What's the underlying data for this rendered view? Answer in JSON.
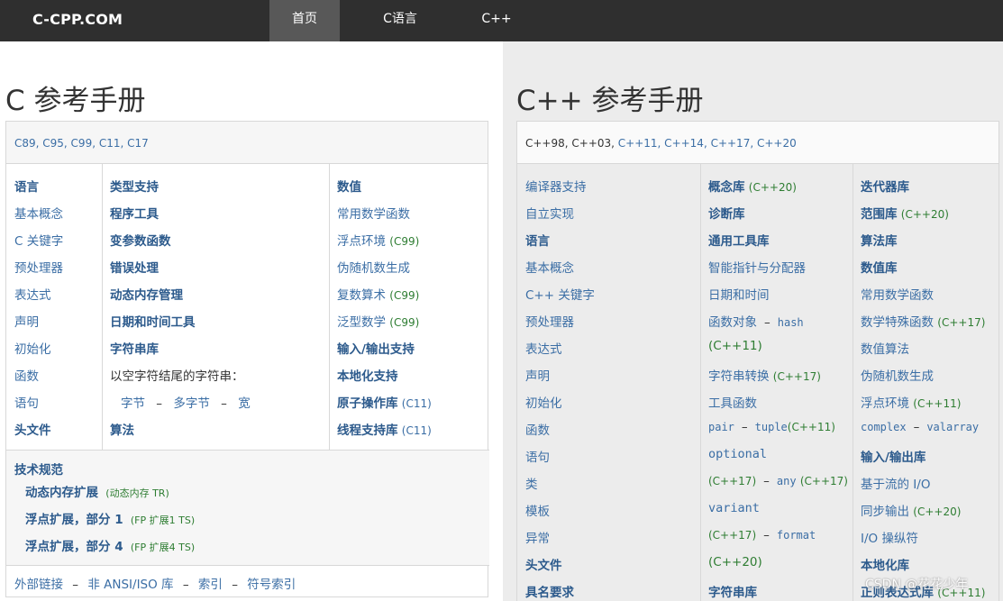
{
  "nav": {
    "brand": "C-CPP.COM",
    "items": [
      "首页",
      "C语言",
      "C++"
    ]
  },
  "c_ref": {
    "title": "C 参考手册",
    "standards": "C89, C95, C99, C11, C17",
    "col1": [
      "语言",
      "基本概念",
      "C 关键字",
      "预处理器",
      "表达式",
      "声明",
      "初始化",
      "函数",
      "语句",
      "头文件"
    ],
    "col2": [
      "类型支持",
      "程序工具",
      "变参数函数",
      "错误处理",
      "动态内存管理",
      "日期和时间工具",
      "字符串库",
      "以空字符结尾的字符串：",
      "字节",
      "–",
      "多字节",
      "–",
      "宽",
      "算法"
    ],
    "col3": [
      {
        "label": "数值",
        "tag": ""
      },
      {
        "label": "常用数学函数",
        "tag": ""
      },
      {
        "label": "浮点环境",
        "tag": "(C99)"
      },
      {
        "label": "伪随机数生成",
        "tag": ""
      },
      {
        "label": "复数算术",
        "tag": "(C99)"
      },
      {
        "label": "泛型数学",
        "tag": "(C99)"
      },
      {
        "label": "输入/输出支持",
        "tag": ""
      },
      {
        "label": "本地化支持",
        "tag": ""
      },
      {
        "label": "原子操作库",
        "tag": "(C11)"
      },
      {
        "label": "线程支持库",
        "tag": "(C11)"
      }
    ],
    "tech_specs": {
      "title": "技术规范",
      "items": [
        {
          "label": "动态内存扩展",
          "tag": "(动态内存 TR)"
        },
        {
          "label": "浮点扩展，部分 1",
          "tag": "(FP 扩展1 TS)"
        },
        {
          "label": "浮点扩展，部分 4",
          "tag": "(FP 扩展4 TS)"
        }
      ]
    },
    "footer": [
      "外部链接",
      "–",
      "非 ANSI/ISO 库",
      "–",
      "索引",
      "–",
      "符号索引"
    ]
  },
  "cpp_ref": {
    "title": "C++ 参考手册",
    "standards_plain": "C++98, C++03,",
    "standards_links": "C++11, C++14, C++17, C++20",
    "col1": [
      "编译器支持",
      "自立实现",
      "语言",
      "基本概念",
      "C++ 关键字",
      "预处理器",
      "表达式",
      "声明",
      "初始化",
      "函数",
      "语句",
      "类",
      "模板",
      "异常",
      "头文件",
      "具名要求"
    ],
    "col2": {
      "concepts": "概念库",
      "concepts_tag": "(C++20)",
      "diagnostics": "诊断库",
      "utilities": "通用工具库",
      "smart_ptr": "智能指针与分配器",
      "datetime": "日期和时间",
      "func_obj": "函数对象",
      "dash": "–",
      "hash": "hash",
      "cpp11": "(C++11)",
      "str_conv": "字符串转换",
      "cpp17": "(C++17)",
      "util_func": "工具函数",
      "pair": "pair",
      "tuple": "tuple",
      "tuple_tag": "(C++11)",
      "optional": "optional",
      "opt_tag": "(C++17)",
      "any": "any",
      "any_tag": "(C++17)",
      "variant": "variant",
      "var_tag": "(C++17)",
      "format": "format",
      "fmt_tag": "(C++20)",
      "strings": "字符串库"
    },
    "col3": {
      "iterators": "迭代器库",
      "ranges": "范围库",
      "ranges_tag": "(C++20)",
      "algorithms": "算法库",
      "numerics": "数值库",
      "math": "常用数学函数",
      "special_math": "数学特殊函数",
      "special_tag": "(C++17)",
      "num_alg": "数值算法",
      "random": "伪随机数生成",
      "fenv": "浮点环境",
      "fenv_tag": "(C++11)",
      "complex": "complex",
      "valarray": "valarray",
      "io": "输入/输出库",
      "stream_io": "基于流的 I/O",
      "sync_out": "同步输出",
      "sync_tag": "(C++20)",
      "io_manip": "I/O 操纵符",
      "locale": "本地化库",
      "regex": "正则表达式库",
      "regex_tag": "(C++11)"
    }
  },
  "watermark": "CSDN @花花少年"
}
